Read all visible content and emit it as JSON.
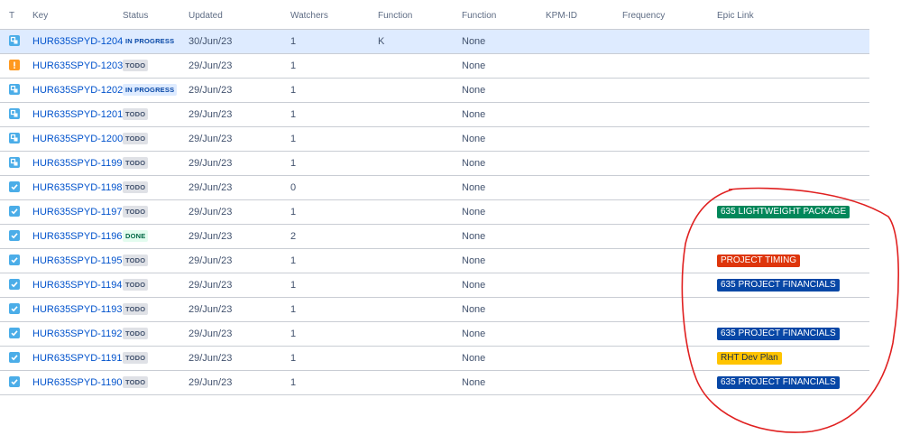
{
  "columns": {
    "t": "T",
    "key": "Key",
    "status": "Status",
    "updated": "Updated",
    "watchers": "Watchers",
    "function1": "Function",
    "function2": "Function",
    "kpm_id": "KPM-ID",
    "frequency": "Frequency",
    "epic_link": "Epic Link"
  },
  "rows": [
    {
      "type": "subtask",
      "key": "HUR635SPYD-1204",
      "status": "IN PROGRESS",
      "status_kind": "progress",
      "updated": "30/Jun/23",
      "watchers": "1",
      "function1": "K",
      "function2": "None",
      "epic": "",
      "epic_color": "",
      "selected": true
    },
    {
      "type": "warning",
      "key": "HUR635SPYD-1203",
      "status": "TODO",
      "status_kind": "todo",
      "updated": "29/Jun/23",
      "watchers": "1",
      "function1": "",
      "function2": "None",
      "epic": "",
      "epic_color": ""
    },
    {
      "type": "subtask",
      "key": "HUR635SPYD-1202",
      "status": "IN PROGRESS",
      "status_kind": "progress",
      "updated": "29/Jun/23",
      "watchers": "1",
      "function1": "",
      "function2": "None",
      "epic": "",
      "epic_color": ""
    },
    {
      "type": "subtask",
      "key": "HUR635SPYD-1201",
      "status": "TODO",
      "status_kind": "todo",
      "updated": "29/Jun/23",
      "watchers": "1",
      "function1": "",
      "function2": "None",
      "epic": "",
      "epic_color": ""
    },
    {
      "type": "subtask",
      "key": "HUR635SPYD-1200",
      "status": "TODO",
      "status_kind": "todo",
      "updated": "29/Jun/23",
      "watchers": "1",
      "function1": "",
      "function2": "None",
      "epic": "",
      "epic_color": ""
    },
    {
      "type": "subtask",
      "key": "HUR635SPYD-1199",
      "status": "TODO",
      "status_kind": "todo",
      "updated": "29/Jun/23",
      "watchers": "1",
      "function1": "",
      "function2": "None",
      "epic": "",
      "epic_color": ""
    },
    {
      "type": "task",
      "key": "HUR635SPYD-1198",
      "status": "TODO",
      "status_kind": "todo",
      "updated": "29/Jun/23",
      "watchers": "0",
      "function1": "",
      "function2": "None",
      "epic": "",
      "epic_color": ""
    },
    {
      "type": "task",
      "key": "HUR635SPYD-1197",
      "status": "TODO",
      "status_kind": "todo",
      "updated": "29/Jun/23",
      "watchers": "1",
      "function1": "",
      "function2": "None",
      "epic": "635 LIGHTWEIGHT PACKAGE",
      "epic_color": "#00875a"
    },
    {
      "type": "task",
      "key": "HUR635SPYD-1196",
      "status": "DONE",
      "status_kind": "done",
      "updated": "29/Jun/23",
      "watchers": "2",
      "function1": "",
      "function2": "None",
      "epic": "",
      "epic_color": ""
    },
    {
      "type": "task",
      "key": "HUR635SPYD-1195",
      "status": "TODO",
      "status_kind": "todo",
      "updated": "29/Jun/23",
      "watchers": "1",
      "function1": "",
      "function2": "None",
      "epic": "PROJECT TIMING",
      "epic_color": "#de350b"
    },
    {
      "type": "task",
      "key": "HUR635SPYD-1194",
      "status": "TODO",
      "status_kind": "todo",
      "updated": "29/Jun/23",
      "watchers": "1",
      "function1": "",
      "function2": "None",
      "epic": "635 PROJECT FINANCIALS",
      "epic_color": "#0747a6"
    },
    {
      "type": "task",
      "key": "HUR635SPYD-1193",
      "status": "TODO",
      "status_kind": "todo",
      "updated": "29/Jun/23",
      "watchers": "1",
      "function1": "",
      "function2": "None",
      "epic": "",
      "epic_color": ""
    },
    {
      "type": "task",
      "key": "HUR635SPYD-1192",
      "status": "TODO",
      "status_kind": "todo",
      "updated": "29/Jun/23",
      "watchers": "1",
      "function1": "",
      "function2": "None",
      "epic": "635 PROJECT FINANCIALS",
      "epic_color": "#0747a6"
    },
    {
      "type": "task",
      "key": "HUR635SPYD-1191",
      "status": "TODO",
      "status_kind": "todo",
      "updated": "29/Jun/23",
      "watchers": "1",
      "function1": "",
      "function2": "None",
      "epic": "RHT Dev Plan",
      "epic_color": "#ffc400",
      "epic_text_color": "#172b4d"
    },
    {
      "type": "task",
      "key": "HUR635SPYD-1190",
      "status": "TODO",
      "status_kind": "todo",
      "updated": "29/Jun/23",
      "watchers": "1",
      "function1": "",
      "function2": "None",
      "epic": "635 PROJECT FINANCIALS",
      "epic_color": "#0747a6"
    }
  ],
  "colors": {
    "link": "#0052cc",
    "selected_row": "#deebff",
    "annotation": "#e02020"
  },
  "icons": {
    "subtask": "subtask-icon",
    "task": "task-checkbox-icon",
    "warning": "warning-icon"
  }
}
